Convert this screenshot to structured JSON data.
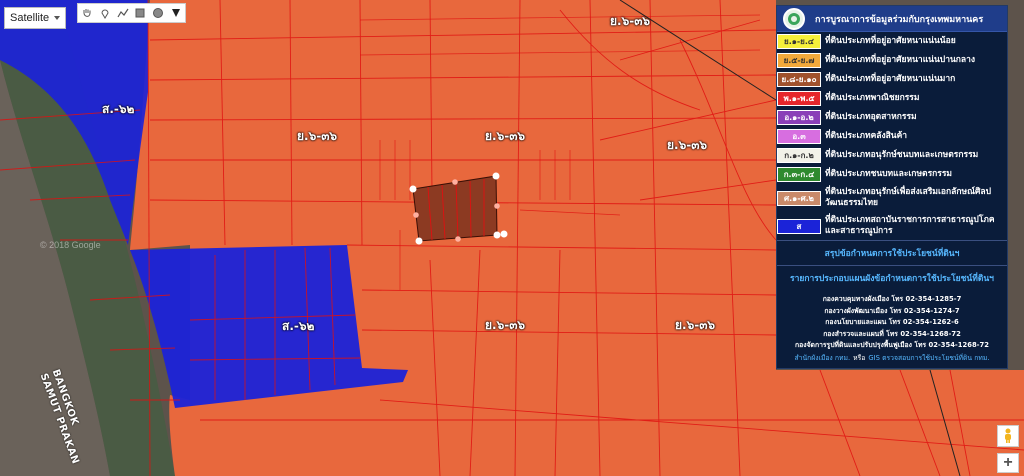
{
  "map_type": {
    "selected": "Satellite"
  },
  "draw_tools": [
    "hand-icon",
    "marker-icon",
    "polyline-icon",
    "rectangle-icon",
    "circle-icon",
    "pen-icon"
  ],
  "labels": {
    "zone_y636_top": "ย.๖-๓๖",
    "zone_y636_mid_left": "ย.๖-๓๖",
    "zone_y636_mid_center": "ย.๖-๓๖",
    "zone_y636_mid_right": "ย.๖-๓๖",
    "zone_y636_bottom_center": "ย.๖-๓๖",
    "zone_y636_bottom_right": "ย.๖-๓๖",
    "zone_s62_top": "ส.-๖๒",
    "zone_s62_bottom": "ส.-๖๒",
    "bangkok": "BANGKOK",
    "samut_prakan": "SAMUT PRAKAN",
    "copyright": "© 2018 Google"
  },
  "legend": {
    "title": "การบูรณาการข้อมูลร่วมกับกรุงเทพมหานคร",
    "items": [
      {
        "code": "ย.๑-ย.๔",
        "label": "ที่ดินประเภทที่อยู่อาศัยหนาแน่นน้อย",
        "color": "#f6f03a",
        "text_color": "#333333"
      },
      {
        "code": "ย.๕-ย.๗",
        "label": "ที่ดินประเภทที่อยู่อาศัยหนาแน่นปานกลาง",
        "color": "#f2a93b",
        "text_color": "#333333"
      },
      {
        "code": "ย.๘-ย.๑๐",
        "label": "ที่ดินประเภทที่อยู่อาศัยหนาแน่นมาก",
        "color": "#a0522d",
        "text_color": "#ffffff"
      },
      {
        "code": "พ.๑-พ.๕",
        "label": "ที่ดินประเภทพาณิชยกรรม",
        "color": "#e6262b",
        "text_color": "#ffffff"
      },
      {
        "code": "อ.๑-อ.๒",
        "label": "ที่ดินประเภทอุตสาหกรรม",
        "color": "#8a3fb8",
        "text_color": "#ffffff"
      },
      {
        "code": "อ.๓",
        "label": "ที่ดินประเภทคลังสินค้า",
        "color": "#d76ee0",
        "text_color": "#ffffff"
      },
      {
        "code": "ก.๑-ก.๒",
        "label": "ที่ดินประเภทอนุรักษ์ชนบทและเกษตรกรรม",
        "color": "#f2f2e8",
        "text_color": "#333333"
      },
      {
        "code": "ก.๓-ก.๔",
        "label": "ที่ดินประเภทชนบทและเกษตรกรรม",
        "color": "#2e8a2e",
        "text_color": "#ffffff"
      },
      {
        "code": "ศ.๑-ศ.๒",
        "label": "ที่ดินประเภทอนุรักษ์เพื่อส่งเสริมเอกลักษณ์ศิลปวัฒนธรรมไทย",
        "color": "#c98a6a",
        "text_color": "#ffffff",
        "tall": true
      },
      {
        "code": "ส",
        "label": "ที่ดินประเภทสถาบันราชการการสาธารณูปโภคและสาธารณูปการ",
        "color": "#1b23d8",
        "text_color": "#ffffff",
        "tall": true
      }
    ],
    "summary_link": "สรุปข้อกำหนดการใช้ประโยชน์ที่ดินฯ",
    "details_link": "รายการประกอบแผนผังข้อกำหนดการใช้ประโยชน์ที่ดินฯ",
    "contacts": [
      "กองควบคุมทางผังเมือง โทร 02-354-1285-7",
      "กองวางผังพัฒนาเมือง โทร 02-354-1274-7",
      "กองนโยบายและแผน โทร 02-354-1262-6",
      "กองสำรวจและแผนที่ โทร 02-354-1268-72",
      "กองจัดการรูปที่ดินและปรับปรุงพื้นฟูเมือง โทร 02-354-1268-72"
    ],
    "footer_prefix": "สำนักผังเมือง กทม.",
    "footer_mid": "หรือ",
    "footer_link": "GIS ตรวจสอบการใช้ประโยชน์ที่ดิน กทม."
  },
  "colors": {
    "residential_high": "#f46a3c",
    "institutional": "#1b23d8",
    "parcel_line": "#e01010",
    "selected_parcel": "#8c3a22"
  }
}
